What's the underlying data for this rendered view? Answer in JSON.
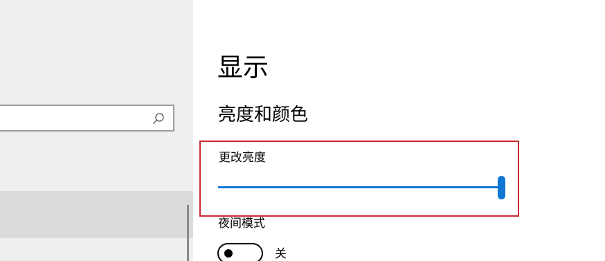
{
  "sidebar": {
    "search": {
      "value": "",
      "placeholder": "",
      "icon": "search-icon"
    }
  },
  "main": {
    "page_title": "显示",
    "section_title": "亮度和颜色",
    "brightness": {
      "label": "更改亮度",
      "value_fraction": 1.0
    },
    "night_light": {
      "label": "夜间模式",
      "state_text": "关",
      "on": false
    }
  },
  "colors": {
    "accent": "#0f78d4",
    "highlight_border": "#c9282d",
    "sidebar_bg": "#eef0f0"
  }
}
